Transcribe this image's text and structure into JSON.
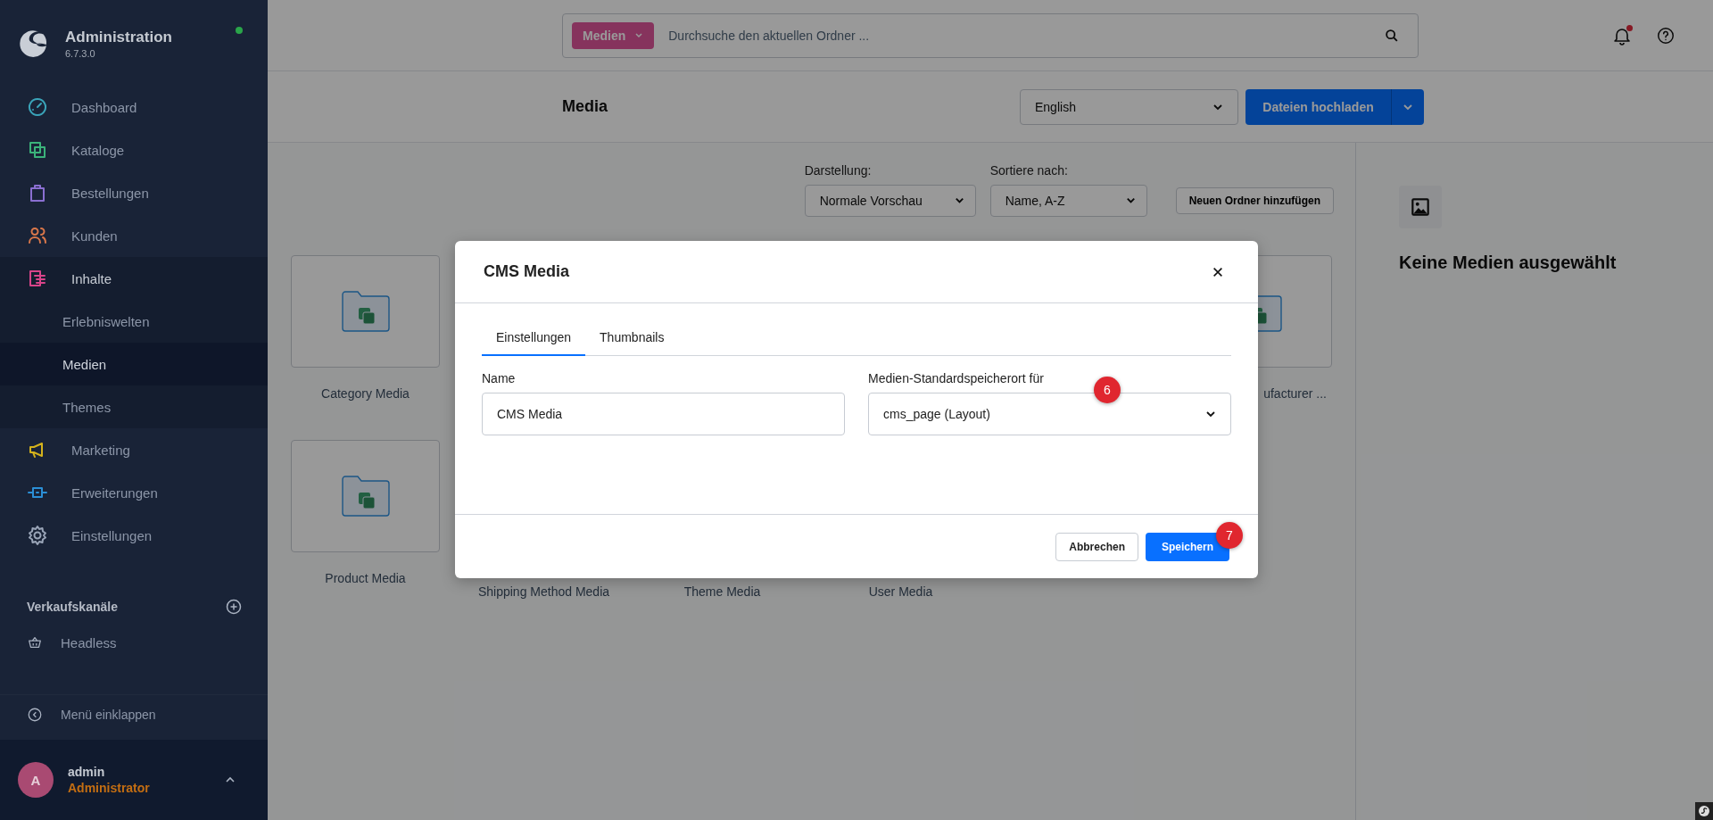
{
  "sidebar": {
    "title": "Administration",
    "version": "6.7.3.0",
    "online": true,
    "nav": [
      {
        "label": "Dashboard",
        "color": "#3aa3b8",
        "selected": false,
        "expanded": false
      },
      {
        "label": "Kataloge",
        "color": "#3bb27a",
        "selected": false,
        "expanded": false
      },
      {
        "label": "Bestellungen",
        "color": "#8a6fd1",
        "selected": false,
        "expanded": false
      },
      {
        "label": "Kunden",
        "color": "#d9774a",
        "selected": false,
        "expanded": false
      },
      {
        "label": "Inhalte",
        "color": "#d9448a",
        "selected": false,
        "expanded": true,
        "children": [
          {
            "label": "Erlebniswelten",
            "selected": false
          },
          {
            "label": "Medien",
            "selected": true
          },
          {
            "label": "Themes",
            "selected": false
          }
        ]
      },
      {
        "label": "Marketing",
        "color": "#d4b21c",
        "selected": false,
        "expanded": false
      },
      {
        "label": "Erweiterungen",
        "color": "#2b8fd6",
        "selected": false,
        "expanded": false
      },
      {
        "label": "Einstellungen",
        "color": "#9aa5b8",
        "selected": false,
        "expanded": false
      }
    ],
    "sales_channels": {
      "heading": "Verkaufskanäle",
      "items": [
        {
          "label": "Headless"
        }
      ]
    },
    "collapse": "Menü einklappen",
    "user": {
      "initial": "A",
      "name": "admin",
      "role": "Administrator"
    }
  },
  "search": {
    "filter": "Medien",
    "placeholder": "Durchsuche den aktuellen Ordner ..."
  },
  "notifications": {
    "unread": true
  },
  "header": {
    "title": "Media",
    "language": "English",
    "upload_button": "Dateien hochladen"
  },
  "toolbar": {
    "view_label": "Darstellung:",
    "view_value": "Normale Vorschau",
    "sort_label": "Sortiere nach:",
    "sort_value": "Name, A-Z",
    "new_folder_button": "Neuen Ordner hinzufügen"
  },
  "folder_rows": [
    [
      {
        "label": "Category Media"
      },
      {
        "label": "ufacturer ..."
      }
    ],
    [
      {
        "label": "Product Media"
      },
      {
        "label": "Shipping Method Media"
      },
      {
        "label": "Theme Media"
      },
      {
        "label": "User Media"
      }
    ]
  ],
  "detail_panel": {
    "empty_text": "Keine Medien ausgewählt"
  },
  "modal": {
    "title": "CMS Media",
    "tabs": [
      {
        "label": "Einstellungen",
        "selected": true
      },
      {
        "label": "Thumbnails",
        "selected": false
      }
    ],
    "name_label": "Name",
    "name_value": "CMS Media",
    "location_label": "Medien-Standardspeicherort für",
    "location_value": "cms_page (Layout)",
    "cancel_button": "Abbrechen",
    "save_button": "Speichern",
    "annotations": [
      {
        "label": "6"
      },
      {
        "label": "7"
      }
    ]
  }
}
